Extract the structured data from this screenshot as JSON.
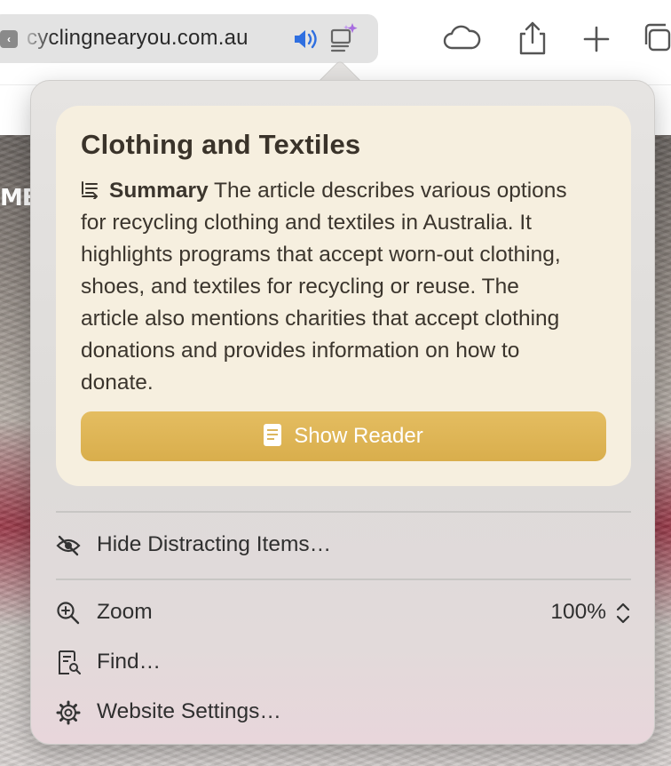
{
  "toolbar": {
    "url": "cyclingnearyou.com.au",
    "icons": [
      "speaker-icon",
      "reader-ai-icon",
      "icloud-tabs-icon",
      "share-icon",
      "new-tab-icon",
      "tab-overview-icon"
    ]
  },
  "page": {
    "heading_fragment": "ME"
  },
  "popover": {
    "summary": {
      "title": "Clothing and Textiles",
      "label": "Summary",
      "text": "The article describes various options for recycling clothing and textiles in Australia. It highlights programs that accept worn-out clothing, shoes, and textiles for recycling or reuse. The article also mentions charities that accept clothing donations and provides information on how to donate.",
      "button_label": "Show Reader"
    },
    "menu": {
      "hide_distracting": "Hide Distracting Items…",
      "zoom_label": "Zoom",
      "zoom_value": "100%",
      "find": "Find…",
      "website_settings": "Website Settings…"
    }
  },
  "colors": {
    "accent_gold": "#dcb252",
    "speaker_blue": "#2f6fe0",
    "summary_bg": "#f6efdf"
  }
}
